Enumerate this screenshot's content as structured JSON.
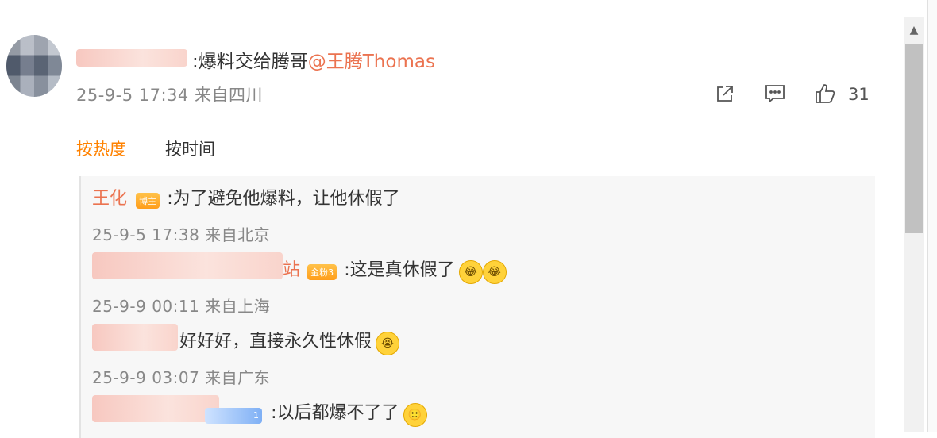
{
  "comment": {
    "name_suffix": ":爆料交给腾哥",
    "mention": "@王腾Thomas",
    "timestamp": "25-9-5 17:34 来自四川",
    "likes": "31"
  },
  "sort": {
    "hot": "按热度",
    "time": "按时间"
  },
  "replies": [
    {
      "name": "王化",
      "badge": "博主",
      "text": ":为了避免他爆料，让他休假了",
      "meta": "25-9-5 17:38 来自北京"
    },
    {
      "name_tail": "站",
      "badge": "金粉3",
      "text": ":这是真休假了",
      "emoji": [
        "cry-laugh-emoji",
        "cry-laugh-emoji"
      ],
      "meta": "25-9-9 00:11 来自上海"
    },
    {
      "text": "好好好，直接永久性休假",
      "emoji": [
        "crying-emoji"
      ],
      "meta": "25-9-9 03:07 来自广东"
    },
    {
      "badge_tail": "1",
      "text": ":以后都爆不了了",
      "emoji": [
        "smile-emoji"
      ]
    }
  ]
}
